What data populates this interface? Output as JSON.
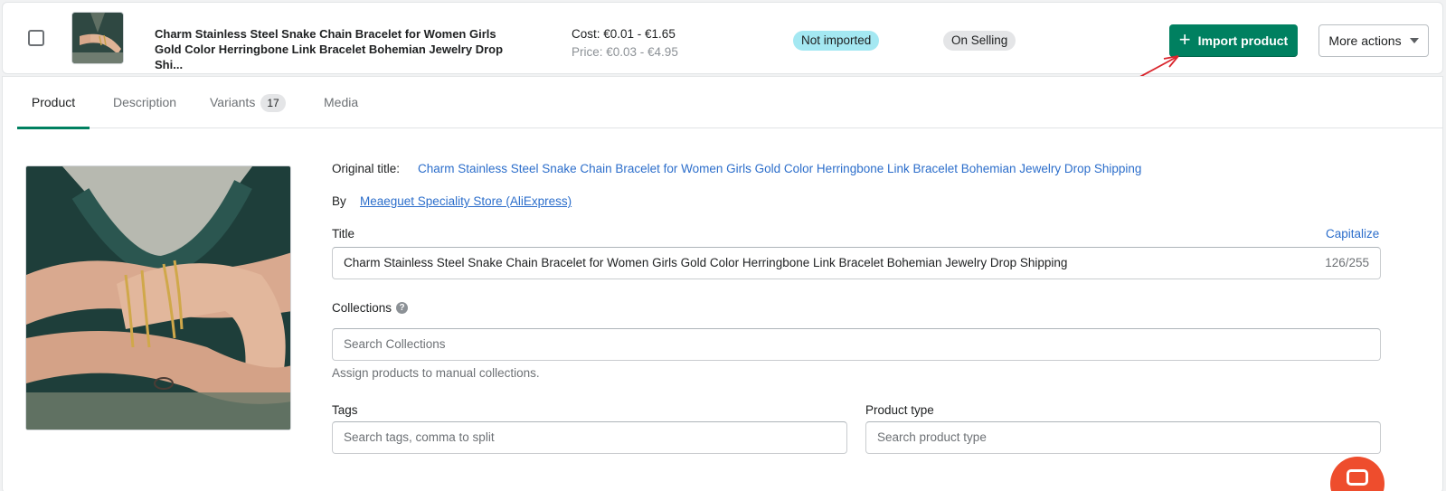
{
  "header": {
    "product_title": "Charm Stainless Steel Snake Chain Bracelet for Women Girls Gold Color Herringbone Link Bracelet Bohemian Jewelry Drop Shi...",
    "cost": "Cost: €0.01 - €1.65",
    "price": "Price: €0.03 - €4.95",
    "import_status": "Not imported",
    "selling_status": "On Selling",
    "import_button": "Import product",
    "more_actions": "More actions"
  },
  "tabs": [
    {
      "label": "Product"
    },
    {
      "label": "Description"
    },
    {
      "label": "Variants",
      "count": "17"
    },
    {
      "label": "Media"
    }
  ],
  "form": {
    "original_title_label": "Original title:",
    "original_title_value": "Charm Stainless Steel Snake Chain Bracelet for Women Girls Gold Color Herringbone Link Bracelet Bohemian Jewelry Drop Shipping",
    "by_label": "By",
    "store_name": "Meaeguet Speciality Store (AliExpress)",
    "title_label": "Title",
    "capitalize": "Capitalize",
    "title_value": "Charm Stainless Steel Snake Chain Bracelet for Women Girls Gold Color Herringbone Link Bracelet Bohemian Jewelry Drop Shipping",
    "title_counter": "126/255",
    "collections_label": "Collections",
    "collections_placeholder": "Search Collections",
    "collections_help": "Assign products to manual collections.",
    "tags_label": "Tags",
    "tags_placeholder": "Search tags, comma to split",
    "product_type_label": "Product type",
    "product_type_placeholder": "Search product type"
  },
  "colors": {
    "primary": "#008060",
    "link": "#2c6ecb",
    "badge_not_imported": "#a4e8f2",
    "badge_on_selling": "#e4e5e7",
    "annotation_arrow": "#d9252c",
    "chat": "#ee4d2d"
  }
}
